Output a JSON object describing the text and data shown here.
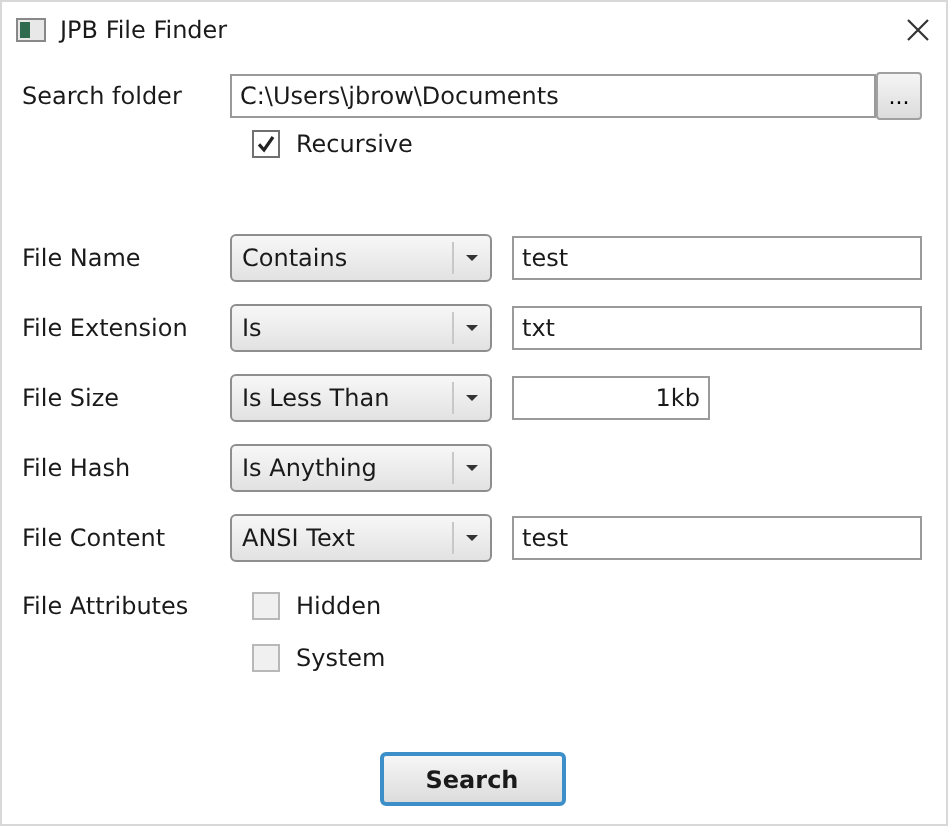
{
  "window": {
    "title": "JPB File Finder"
  },
  "search_folder": {
    "label": "Search folder",
    "value": "C:\\Users\\jbrow\\Documents",
    "browse_button": "...",
    "recursive": {
      "label": "Recursive",
      "checked": true
    }
  },
  "filters": [
    {
      "label": "File Name",
      "operator": "Contains",
      "kind": "text",
      "value": "test"
    },
    {
      "label": "File Extension",
      "operator": "Is",
      "kind": "text",
      "value": "txt"
    },
    {
      "label": "File Size",
      "operator": "Is Less Than",
      "kind": "number",
      "value": "1kb"
    },
    {
      "label": "File Hash",
      "operator": "Is Anything",
      "kind": "none"
    },
    {
      "label": "File Content",
      "operator": "ANSI Text",
      "kind": "text",
      "value": "test"
    }
  ],
  "attributes": {
    "label": "File Attributes",
    "options": [
      {
        "label": "Hidden",
        "checked": false
      },
      {
        "label": "System",
        "checked": false
      }
    ]
  },
  "search_button": "Search"
}
